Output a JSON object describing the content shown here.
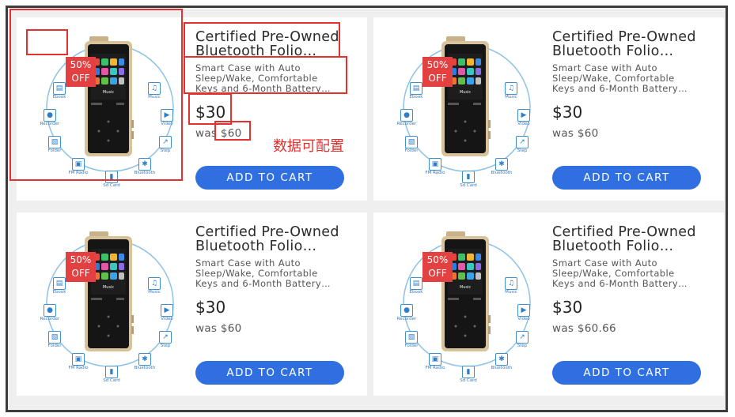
{
  "cards": [
    {
      "badge_pct": "50%",
      "badge_off": "OFF",
      "title_l1": "Certified Pre-Owned",
      "title_l2": "Bluetooth Folio…",
      "desc_l1": "Smart Case with Auto",
      "desc_l2": "Sleep/Wake, Comfortable",
      "desc_l3": "Keys and 6-Month Battery…",
      "price": "$30",
      "was_label": "was",
      "was_value": "$60",
      "button": "ADD TO CART"
    },
    {
      "badge_pct": "50%",
      "badge_off": "OFF",
      "title_l1": "Certified Pre-Owned",
      "title_l2": "Bluetooth Folio…",
      "desc_l1": "Smart Case with Auto",
      "desc_l2": "Sleep/Wake, Comfortable",
      "desc_l3": "Keys and 6-Month Battery…",
      "price": "$30",
      "was_label": "was",
      "was_value": "$60",
      "button": "ADD TO CART"
    },
    {
      "badge_pct": "50%",
      "badge_off": "OFF",
      "title_l1": "Certified Pre-Owned",
      "title_l2": "Bluetooth Folio…",
      "desc_l1": "Smart Case with Auto",
      "desc_l2": "Sleep/Wake, Comfortable",
      "desc_l3": "Keys and 6-Month Battery…",
      "price": "$30",
      "was_label": "was",
      "was_value": "$60",
      "button": "ADD TO CART"
    },
    {
      "badge_pct": "50%",
      "badge_off": "OFF",
      "title_l1": "Certified Pre-Owned",
      "title_l2": "Bluetooth Folio…",
      "desc_l1": "Smart Case with Auto",
      "desc_l2": "Sleep/Wake, Comfortable",
      "desc_l3": "Keys and 6-Month Battery…",
      "price": "$30",
      "was_label": "was",
      "was_value": "$60.66",
      "button": "ADD TO CART"
    }
  ],
  "product_image": {
    "ring_labels": [
      "Ebook",
      "Music",
      "Recorder",
      "Video",
      "Folder",
      "Step",
      "FM Radio",
      "Bluetooth",
      "Sd Card"
    ],
    "screen_label": "Music"
  },
  "annotation_note": "数据可配置",
  "colors": {
    "badge": "#e34141",
    "button": "#2f6fe0",
    "annotation": "#e53030",
    "page_bg": "#efefef"
  }
}
